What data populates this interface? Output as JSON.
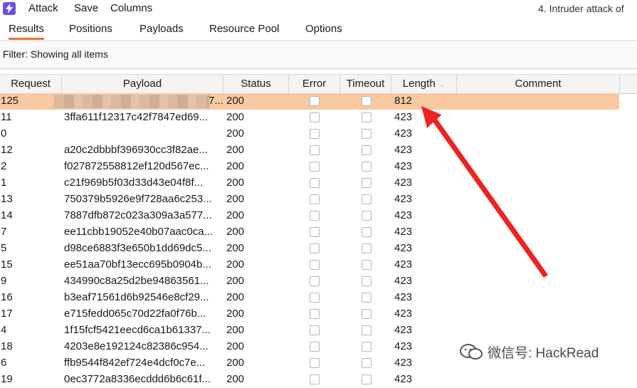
{
  "menu": {
    "items": [
      "Attack",
      "Save",
      "Columns"
    ],
    "window_title": "4. Intruder attack of"
  },
  "tabs": [
    "Results",
    "Positions",
    "Payloads",
    "Resource Pool",
    "Options"
  ],
  "filter": {
    "text": "Filter: Showing all items"
  },
  "table": {
    "columns": [
      "Request",
      "Payload",
      "Status",
      "Error",
      "Timeout",
      "Length",
      "Comment"
    ],
    "rows": [
      {
        "request": "125",
        "payload": "7...",
        "status": "200",
        "length": "812",
        "selected": true
      },
      {
        "request": "11",
        "payload": "3ffa611f12317c42f7847ed69...",
        "status": "200",
        "length": "423"
      },
      {
        "request": "0",
        "payload": "",
        "status": "200",
        "length": "423"
      },
      {
        "request": "12",
        "payload": "a20c2dbbbf396930cc3f82ae...",
        "status": "200",
        "length": "423"
      },
      {
        "request": "2",
        "payload": "f027872558812ef120d567ec...",
        "status": "200",
        "length": "423"
      },
      {
        "request": "1",
        "payload": "c21f969b5f03d33d43e04f8f...",
        "status": "200",
        "length": "423"
      },
      {
        "request": "13",
        "payload": "750379b5926e9f728aa6c253...",
        "status": "200",
        "length": "423"
      },
      {
        "request": "14",
        "payload": "7887dfb872c023a309a3a577...",
        "status": "200",
        "length": "423"
      },
      {
        "request": "7",
        "payload": "ee11cbb19052e40b07aac0ca...",
        "status": "200",
        "length": "423"
      },
      {
        "request": "5",
        "payload": "d98ce6883f3e650b1dd69dc5...",
        "status": "200",
        "length": "423"
      },
      {
        "request": "15",
        "payload": "ee51aa70bf13ecc695b0904b...",
        "status": "200",
        "length": "423"
      },
      {
        "request": "9",
        "payload": "434990c8a25d2be94863561...",
        "status": "200",
        "length": "423"
      },
      {
        "request": "16",
        "payload": "b3eaf71561d6b92546e8cf29...",
        "status": "200",
        "length": "423"
      },
      {
        "request": "17",
        "payload": "e715fedd065c70d22fa0f76b...",
        "status": "200",
        "length": "423"
      },
      {
        "request": "4",
        "payload": "1f15fcf5421eecd6ca1b61337...",
        "status": "200",
        "length": "423"
      },
      {
        "request": "18",
        "payload": "4203e8e192124c82386c954...",
        "status": "200",
        "length": "423"
      },
      {
        "request": "6",
        "payload": "ffb9544f842ef724e4dcf0c7e...",
        "status": "200",
        "length": "423"
      },
      {
        "request": "19",
        "payload": "0ec3772a8336ecddd6b6c61f...",
        "status": "200",
        "length": "423"
      }
    ]
  },
  "watermark": {
    "text": "微信号: HackRead"
  },
  "colors": {
    "selected_row": "#f9c9a1",
    "accent": "#e8743b",
    "arrow": "#ee2222"
  }
}
